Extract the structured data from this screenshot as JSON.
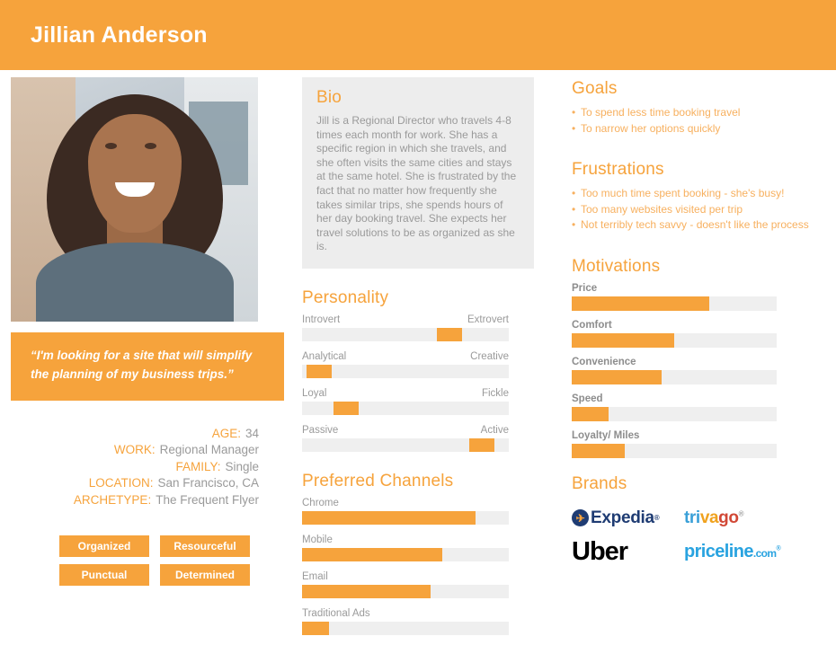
{
  "header": {
    "title": "Jillian Anderson"
  },
  "photo": {
    "alt": "portrait-photo"
  },
  "quote": {
    "text": "“I'm looking for a site that will simplify the planning of my business trips.”"
  },
  "demographics": [
    {
      "label": "AGE:",
      "value": "34"
    },
    {
      "label": "WORK:",
      "value": "Regional Manager"
    },
    {
      "label": "FAMILY:",
      "value": "Single"
    },
    {
      "label": "LOCATION:",
      "value": "San Francisco, CA"
    },
    {
      "label": "ARCHETYPE:",
      "value": "The Frequent Flyer"
    }
  ],
  "tags": [
    {
      "label": "Organized"
    },
    {
      "label": "Resourceful"
    },
    {
      "label": "Punctual"
    },
    {
      "label": "Determined"
    }
  ],
  "bio": {
    "title": "Bio",
    "text": "Jill is a Regional Director who travels 4-8 times each month for work. She has a specific region in which she travels, and she often visits the same cities and stays at the same hotel. She is frustrated by the fact that no matter how frequently she takes similar trips, she spends hours of her day booking travel. She expects her travel solutions to be as organized as she is."
  },
  "personality": {
    "title": "Personality",
    "rows": [
      {
        "left": "Introvert",
        "right": "Extrovert",
        "position": 65
      },
      {
        "left": "Analytical",
        "right": "Creative",
        "position": 2
      },
      {
        "left": "Loyal",
        "right": "Fickle",
        "position": 15
      },
      {
        "left": "Passive",
        "right": "Active",
        "position": 81
      }
    ]
  },
  "channels": {
    "title": "Preferred Channels",
    "rows": [
      {
        "label": "Chrome",
        "value": 84
      },
      {
        "label": "Mobile",
        "value": 68
      },
      {
        "label": "Email",
        "value": 62
      },
      {
        "label": "Traditional Ads",
        "value": 13
      }
    ]
  },
  "goals": {
    "title": "Goals",
    "items": [
      "To spend less time booking travel",
      "To narrow her options quickly"
    ]
  },
  "frustrations": {
    "title": "Frustrations",
    "items": [
      "Too much time spent booking - she's busy!",
      "Too many websites visited per trip",
      "Not terribly tech savvy - doesn't like the process"
    ]
  },
  "motivations": {
    "title": "Motivations",
    "rows": [
      {
        "label": "Price",
        "value": 67
      },
      {
        "label": "Comfort",
        "value": 50
      },
      {
        "label": "Convenience",
        "value": 44
      },
      {
        "label": "Speed",
        "value": 18
      },
      {
        "label": "Loyalty/ Miles",
        "value": 26
      }
    ]
  },
  "brands": {
    "title": "Brands",
    "items": [
      {
        "name": "Expedia",
        "icon": "expedia-airplane-icon"
      },
      {
        "name": "trivago",
        "part1": "tri",
        "part2": "va",
        "part3": "go"
      },
      {
        "name": "Uber"
      },
      {
        "name": "priceline",
        "suffix": ".com"
      }
    ]
  },
  "chart_data": [
    {
      "type": "bar",
      "title": "Personality",
      "categories": [
        "Introvert–Extrovert",
        "Analytical–Creative",
        "Loyal–Fickle",
        "Passive–Active"
      ],
      "values": [
        65,
        2,
        15,
        81
      ],
      "xlabel": "",
      "ylabel": "",
      "ylim": [
        0,
        100
      ],
      "note": "slider knob position, percent from left"
    },
    {
      "type": "bar",
      "title": "Preferred Channels",
      "categories": [
        "Chrome",
        "Mobile",
        "Email",
        "Traditional Ads"
      ],
      "values": [
        84,
        68,
        62,
        13
      ],
      "xlabel": "",
      "ylabel": "",
      "ylim": [
        0,
        100
      ]
    },
    {
      "type": "bar",
      "title": "Motivations",
      "categories": [
        "Price",
        "Comfort",
        "Convenience",
        "Speed",
        "Loyalty/ Miles"
      ],
      "values": [
        67,
        50,
        44,
        18,
        26
      ],
      "xlabel": "",
      "ylabel": "",
      "ylim": [
        0,
        100
      ]
    }
  ],
  "colors": {
    "accent": "#f6a33c",
    "track": "#efefef",
    "card": "#ededed",
    "text": "#9a9a9a"
  }
}
